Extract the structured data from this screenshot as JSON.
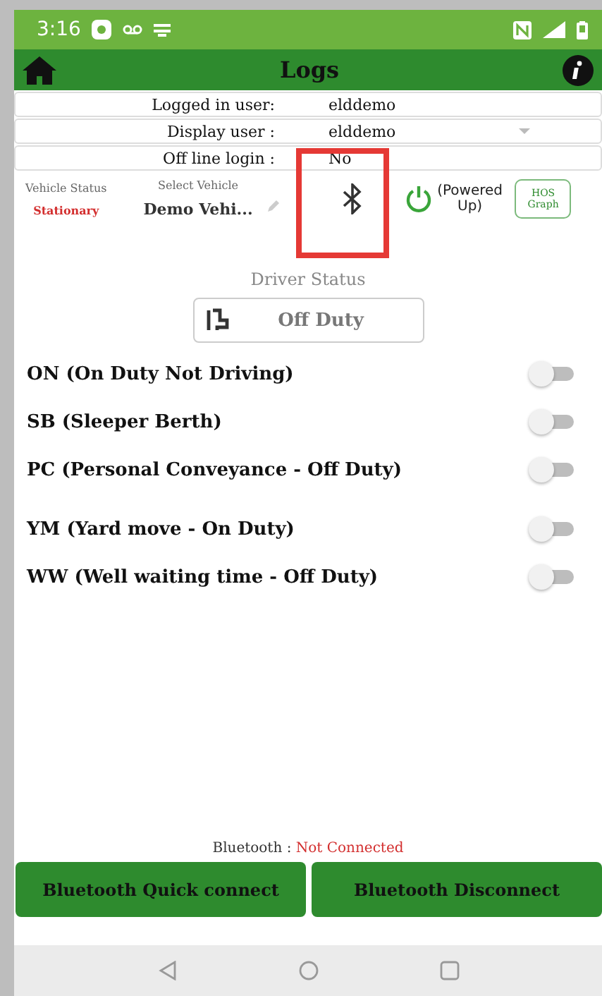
{
  "status_bar": {
    "time": "3:16"
  },
  "header": {
    "title": "Logs"
  },
  "info_rows": [
    {
      "label": "Logged in user:",
      "value": "elddemo",
      "kind": "text"
    },
    {
      "label": "Display user :",
      "value": "elddemo",
      "kind": "dropdown"
    },
    {
      "label": "Off line login :",
      "value": "No",
      "kind": "text"
    }
  ],
  "vehicle": {
    "status_label": "Vehicle Status",
    "status": "Stationary",
    "select_label": "Select Vehicle",
    "vehicle_name": "Demo Vehi...",
    "power_state": "(Powered Up)",
    "graph_button": "HOS Graph"
  },
  "driver_status": {
    "label": "Driver Status",
    "current": "Off Duty"
  },
  "duty_toggles": [
    {
      "label": "ON (On Duty Not Driving)",
      "on": false
    },
    {
      "label": "SB (Sleeper Berth)",
      "on": false
    },
    {
      "label": "PC (Personal Conveyance - Off Duty)",
      "on": false
    },
    {
      "label": "YM (Yard move - On Duty)",
      "on": false
    },
    {
      "label": "WW (Well waiting time - Off Duty)",
      "on": false
    }
  ],
  "bluetooth": {
    "label": "Bluetooth :",
    "state": "Not Connected"
  },
  "buttons": [
    "Bluetooth Quick connect",
    "Bluetooth Disconnect"
  ]
}
